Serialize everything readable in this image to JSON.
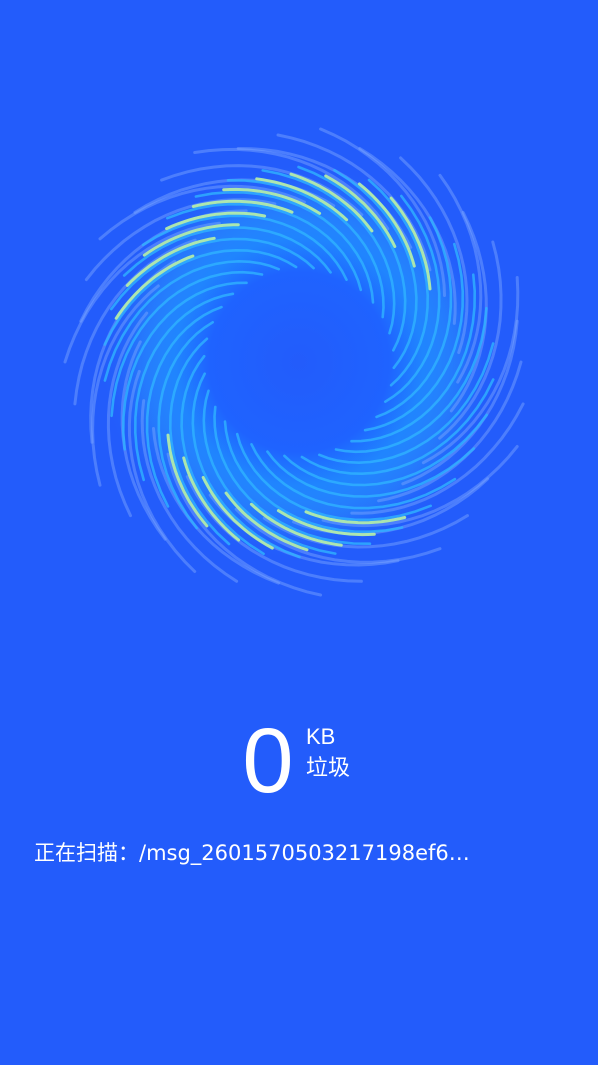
{
  "colors": {
    "background": "#235cfb",
    "ring_inner": "#2fb3ff",
    "ring_highlight": "#b9f2a6",
    "ring_outer": "#7fa8ff"
  },
  "scan_result": {
    "size_value": "0",
    "size_unit": "KB",
    "size_label": "垃圾"
  },
  "scan_status": {
    "prefix": "正在扫描：",
    "path": "/msg_2601570503217198ef6…"
  },
  "animation": {
    "name": "scanning-vortex"
  }
}
